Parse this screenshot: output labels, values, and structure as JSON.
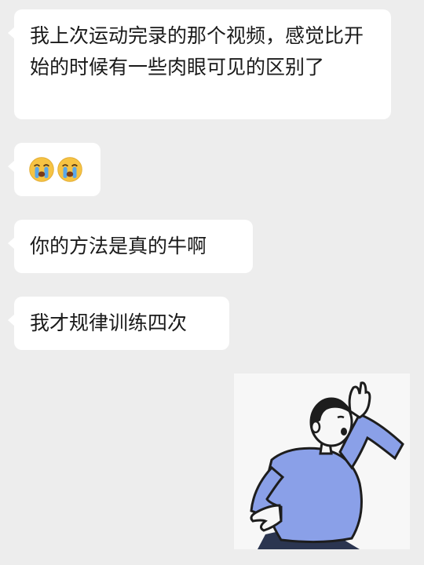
{
  "chat": {
    "messages": [
      {
        "type": "text",
        "text": "我上次运动完录的那个视频，感觉比开始的时候有一些肉眼可见的区别了"
      },
      {
        "type": "emoji",
        "emojis": [
          "crying-face",
          "crying-face"
        ]
      },
      {
        "type": "text",
        "text": "你的方法是真的牛啊"
      },
      {
        "type": "text",
        "text": "我才规律训练四次"
      },
      {
        "type": "sticker",
        "description_icon": "dancing-man-sticker"
      }
    ]
  },
  "colors": {
    "background": "#ededed",
    "bubble": "#ffffff",
    "text": "#1a1a1a",
    "shirt": "#8aa0e8",
    "pants": "#2b3550"
  }
}
